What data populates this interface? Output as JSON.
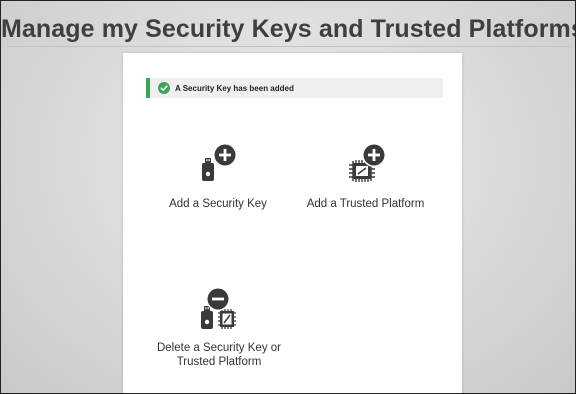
{
  "page": {
    "title": "Manage my Security Keys and Trusted Platforms"
  },
  "notice": {
    "text": "A Security Key has been added",
    "icon": "check-circle-icon",
    "accent_color": "#3aa655"
  },
  "actions": [
    {
      "label": "Add a Security Key",
      "icon": "usb-key-add-icon"
    },
    {
      "label": "Add a Trusted Platform",
      "icon": "chip-add-icon"
    },
    {
      "label_line1": "Delete a Security Key or",
      "label_line2": "Trusted Platform",
      "icon": "key-chip-remove-icon"
    }
  ],
  "colors": {
    "icon_dark": "#3a3a3a",
    "title_text": "#3f3f3f"
  }
}
